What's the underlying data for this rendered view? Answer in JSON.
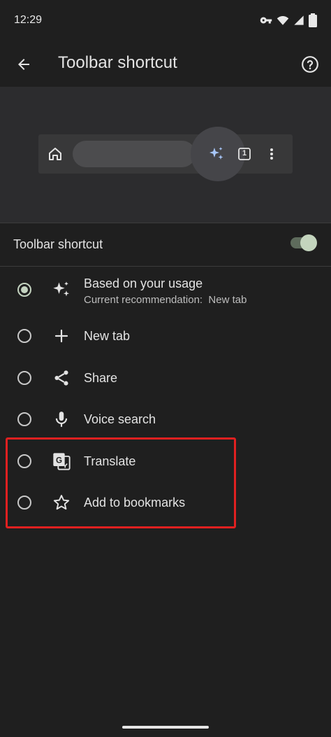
{
  "status_bar": {
    "time": "12:29",
    "icons": [
      "vpn-key-icon",
      "wifi-icon",
      "signal-icon",
      "battery-icon"
    ]
  },
  "app_bar": {
    "title": "Toolbar shortcut",
    "back_icon": "arrow-back-icon",
    "help_icon": "help-icon"
  },
  "preview": {
    "tab_count": "1",
    "icons": [
      "home-icon",
      "sparkle-icon",
      "tab-switcher-icon",
      "more-vert-icon"
    ]
  },
  "toggle": {
    "label": "Toolbar shortcut",
    "enabled": true
  },
  "options": [
    {
      "label": "Based on your usage",
      "sublabel": "Current recommendation:  New tab",
      "icon": "sparkle-icon",
      "selected": true
    },
    {
      "label": "New tab",
      "icon": "plus-icon",
      "selected": false
    },
    {
      "label": "Share",
      "icon": "share-icon",
      "selected": false
    },
    {
      "label": "Voice search",
      "icon": "mic-icon",
      "selected": false
    },
    {
      "label": "Translate",
      "icon": "translate-icon",
      "selected": false
    },
    {
      "label": "Add to bookmarks",
      "icon": "star-outline-icon",
      "selected": false
    }
  ],
  "colors": {
    "background": "#1f1f1f",
    "preview_background": "#2c2c2e",
    "accent": "#c4d3c0",
    "sparkle_accent": "#a8c7fa",
    "annotation": "#e02020"
  }
}
